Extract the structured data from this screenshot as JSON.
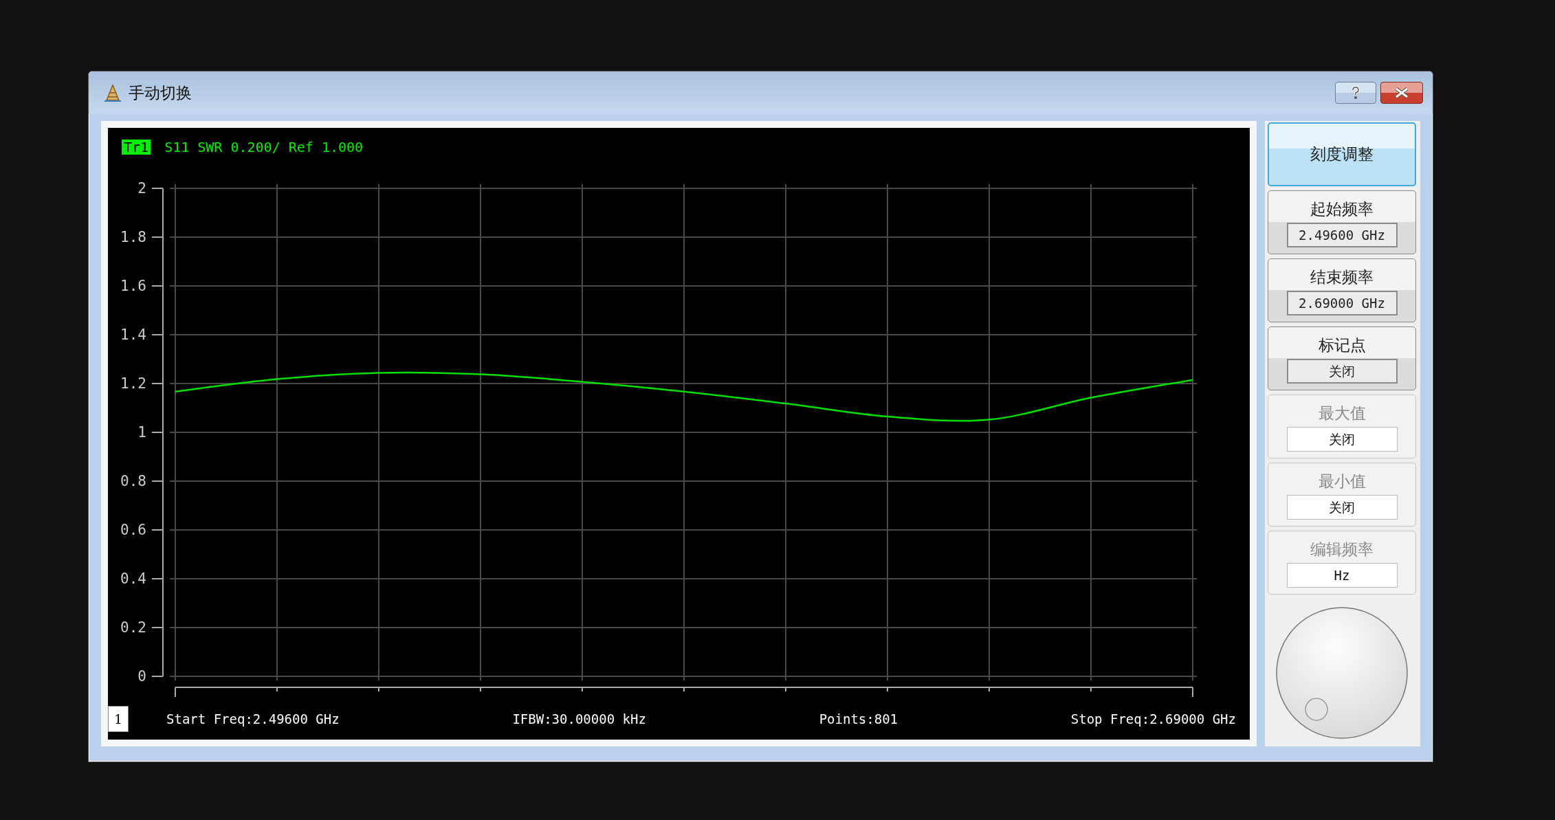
{
  "window": {
    "title": "手动切换"
  },
  "trace": {
    "badge": "Tr1",
    "label": "S11 SWR 0.200/ Ref 1.000"
  },
  "chart": {
    "chart_data": {
      "type": "line",
      "grid": true,
      "ylim": [
        0,
        2
      ],
      "yticks": [
        {
          "value": 0,
          "label": "0"
        },
        {
          "value": 0.2,
          "label": "0.2"
        },
        {
          "value": 0.4,
          "label": "0.4"
        },
        {
          "value": 0.6,
          "label": "0.6"
        },
        {
          "value": 0.8,
          "label": "0.8"
        },
        {
          "value": 1,
          "label": "1"
        },
        {
          "value": 1.2,
          "label": "1.2"
        },
        {
          "value": 1.4,
          "label": "1.4"
        },
        {
          "value": 1.6,
          "label": "1.6"
        },
        {
          "value": 1.8,
          "label": "1.8"
        },
        {
          "value": 2,
          "label": "2"
        }
      ],
      "series": [
        {
          "color": "#00e000",
          "values": [
            1.167,
            1.218,
            1.244,
            1.238,
            1.207,
            1.167,
            1.118,
            1.065,
            1.052,
            1.142,
            1.215
          ]
        }
      ]
    }
  },
  "footer": {
    "channel": "1",
    "items": [
      "Start Freq:2.49600 GHz",
      "IFBW:30.00000 kHz",
      "Points:801",
      "Stop Freq:2.69000 GHz"
    ]
  },
  "side_panel": [
    {
      "kind": "button",
      "label": "刻度调整",
      "selected": true,
      "disabled": false
    },
    {
      "kind": "field",
      "label": "起始频率",
      "value": "2.49600 GHz",
      "selected": false,
      "disabled": false
    },
    {
      "kind": "field",
      "label": "结束频率",
      "value": "2.69000 GHz",
      "selected": false,
      "disabled": false
    },
    {
      "kind": "field",
      "label": "标记点",
      "value": "关闭",
      "selected": false,
      "disabled": false
    },
    {
      "kind": "field",
      "label": "最大值",
      "value": "关闭",
      "selected": false,
      "disabled": true
    },
    {
      "kind": "field",
      "label": "最小值",
      "value": "关闭",
      "selected": false,
      "disabled": true
    },
    {
      "kind": "field",
      "label": "编辑频率",
      "value": "Hz",
      "selected": false,
      "disabled": true
    }
  ]
}
